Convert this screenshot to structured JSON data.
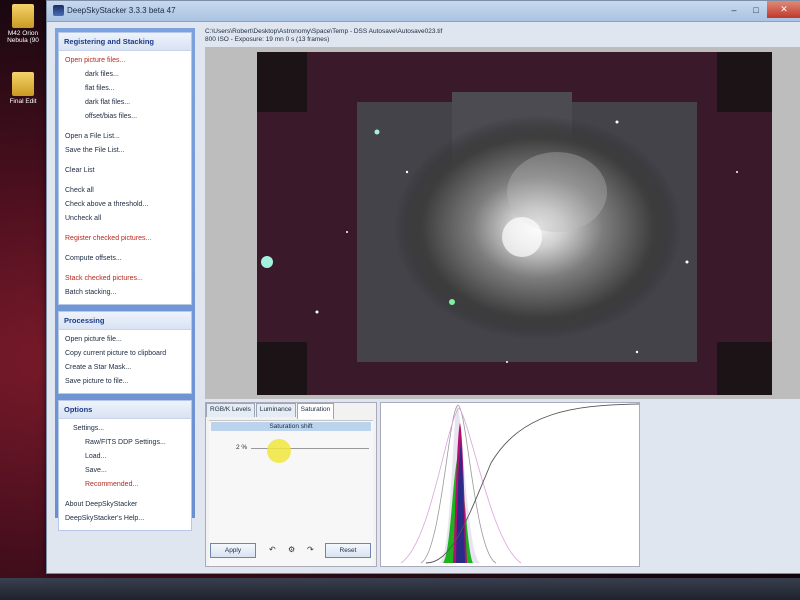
{
  "desktop": {
    "icons": [
      {
        "label": "M42 Orion Nebula (90"
      },
      {
        "label": "Final Edit"
      }
    ]
  },
  "window": {
    "title": "DeepSkyStacker 3.3.3 beta 47",
    "buttons": {
      "minimize": "–",
      "maximize": "□",
      "close": "✕"
    }
  },
  "taskpane": {
    "groups": [
      {
        "title": "Registering and Stacking",
        "items": [
          {
            "label": "Open picture files...",
            "style": "red"
          },
          {
            "label": "dark files...",
            "indent": 2
          },
          {
            "label": "flat files...",
            "indent": 2
          },
          {
            "label": "dark flat files...",
            "indent": 2
          },
          {
            "label": "offset/bias files...",
            "indent": 2
          },
          {
            "label": "Open a File List...",
            "space": true
          },
          {
            "label": "Save the File List..."
          },
          {
            "label": "Clear List",
            "space": true
          },
          {
            "label": "Check all",
            "space": true
          },
          {
            "label": "Check above a threshold..."
          },
          {
            "label": "Uncheck all"
          },
          {
            "label": "Register checked pictures...",
            "style": "red",
            "space": true
          },
          {
            "label": "Compute offsets...",
            "space": true
          },
          {
            "label": "Stack checked pictures...",
            "style": "red",
            "space": true
          },
          {
            "label": "Batch stacking..."
          }
        ]
      },
      {
        "title": "Processing",
        "items": [
          {
            "label": "Open picture file..."
          },
          {
            "label": "Copy current picture to clipboard"
          },
          {
            "label": "Create a Star Mask..."
          },
          {
            "label": "Save picture to file..."
          }
        ]
      },
      {
        "title": "Options",
        "items": [
          {
            "label": "Settings...",
            "indent": 1
          },
          {
            "label": "Raw/FITS DDP Settings...",
            "indent": 2
          },
          {
            "label": "Load...",
            "indent": 2
          },
          {
            "label": "Save...",
            "indent": 2
          },
          {
            "label": "Recommended...",
            "indent": 2,
            "style": "red"
          },
          {
            "label": "About DeepSkyStacker",
            "space": true
          },
          {
            "label": "DeepSkyStacker's Help..."
          }
        ]
      }
    ]
  },
  "file_info": {
    "path": "C:\\Users\\Robert\\Desktop\\Astronomy\\Space\\Temp - DSS Autosave\\Autosave023.tif",
    "details": "800 ISO - Exposure: 19 mn 0 s (13 frames)"
  },
  "tabs": [
    "RGB/K Levels",
    "Luminance",
    "Saturation"
  ],
  "active_tab": "Saturation",
  "saturation": {
    "header": "Saturation shift",
    "value": "2 %"
  },
  "actions": {
    "apply": "Apply",
    "reset": "Reset"
  },
  "icons": [
    "undo-icon",
    "settings-icon",
    "redo-icon"
  ],
  "colors": {
    "accent": "#1b3b8a",
    "red_link": "#b52a1e",
    "highlight": "#f0e63c"
  }
}
